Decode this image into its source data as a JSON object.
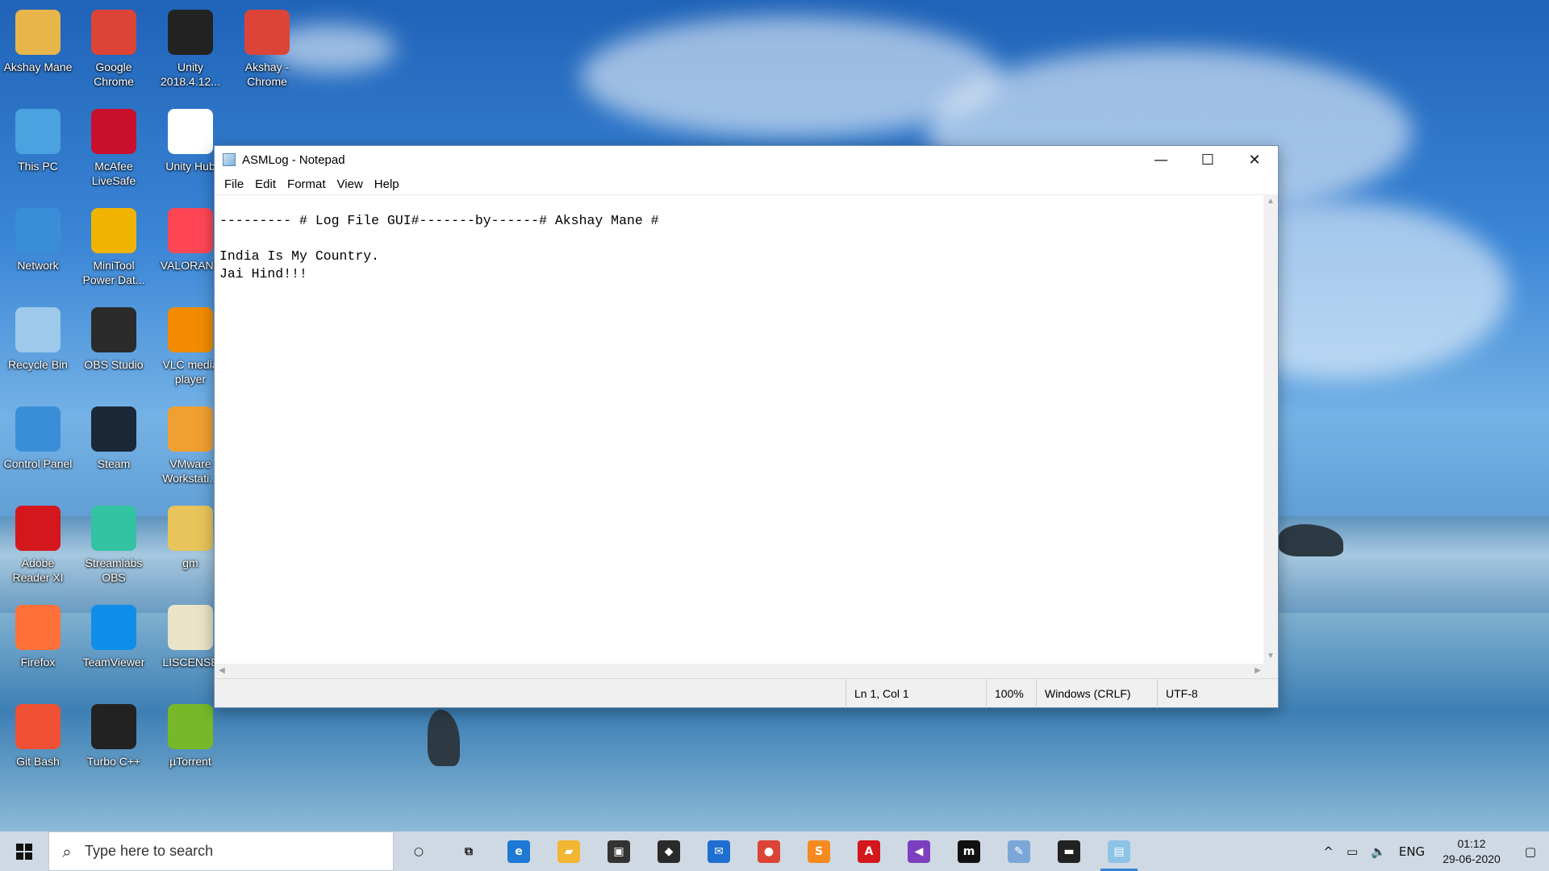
{
  "desktop": {
    "icons": [
      {
        "label": "Akshay Mane",
        "icon": "user-folder-icon",
        "color": "#e8b54a"
      },
      {
        "label": "Google Chrome",
        "icon": "chrome-icon",
        "color": "#db4437"
      },
      {
        "label": "Unity 2018.4.12...",
        "icon": "unity-icon",
        "color": "#222222"
      },
      {
        "label": "Akshay - Chrome",
        "icon": "chrome-profile-icon",
        "color": "#db4437"
      },
      {
        "label": "This PC",
        "icon": "computer-icon",
        "color": "#4aa3e0"
      },
      {
        "label": "McAfee LiveSafe",
        "icon": "mcafee-icon",
        "color": "#c8102e"
      },
      {
        "label": "Unity Hub",
        "icon": "unity-hub-icon",
        "color": "#ffffff"
      },
      {
        "label": "Network",
        "icon": "network-icon",
        "color": "#3a8ed8"
      },
      {
        "label": "MiniTool Power Dat...",
        "icon": "minitool-icon",
        "color": "#f0b400"
      },
      {
        "label": "VALORANT",
        "icon": "valorant-icon",
        "color": "#ff4655"
      },
      {
        "label": "Recycle Bin",
        "icon": "recycle-bin-icon",
        "color": "#9ec9ea"
      },
      {
        "label": "OBS Studio",
        "icon": "obs-icon",
        "color": "#2b2b2b"
      },
      {
        "label": "VLC media player",
        "icon": "vlc-icon",
        "color": "#f28b00"
      },
      {
        "label": "Control Panel",
        "icon": "control-panel-icon",
        "color": "#3a8ed8"
      },
      {
        "label": "Steam",
        "icon": "steam-icon",
        "color": "#1b2838"
      },
      {
        "label": "VMware Workstati...",
        "icon": "vmware-icon",
        "color": "#f0a030"
      },
      {
        "label": "Adobe Reader XI",
        "icon": "adobe-reader-icon",
        "color": "#d4171d"
      },
      {
        "label": "Streamlabs OBS",
        "icon": "streamlabs-icon",
        "color": "#31c3a2"
      },
      {
        "label": "gm",
        "icon": "folder-icon",
        "color": "#e8c45a"
      },
      {
        "label": "Firefox",
        "icon": "firefox-icon",
        "color": "#ff7139"
      },
      {
        "label": "TeamViewer",
        "icon": "teamviewer-icon",
        "color": "#0e8ee9"
      },
      {
        "label": "LISCENSE",
        "icon": "pdf-file-icon",
        "color": "#e9e3c8"
      },
      {
        "label": "Git Bash",
        "icon": "git-bash-icon",
        "color": "#f05033"
      },
      {
        "label": "Turbo C++",
        "icon": "turbo-cpp-icon",
        "color": "#222222"
      },
      {
        "label": "µTorrent",
        "icon": "utorrent-icon",
        "color": "#76b82a"
      }
    ]
  },
  "notepad": {
    "title": "ASMLog - Notepad",
    "controls": {
      "minimize": "—",
      "maximize": "☐",
      "close": "✕"
    },
    "menu": [
      "File",
      "Edit",
      "Format",
      "View",
      "Help"
    ],
    "content": "--------- # Log File GUI#-------by------# Akshay Mane #\n\nIndia Is My Country.\nJai Hind!!!",
    "status": {
      "position": "Ln 1, Col 1",
      "zoom": "100%",
      "line_ending": "Windows (CRLF)",
      "encoding": "UTF-8"
    }
  },
  "taskbar": {
    "search_placeholder": "Type here to search",
    "apps": [
      {
        "name": "cortana",
        "glyph": "○",
        "color": "transparent",
        "text_color": "#111111"
      },
      {
        "name": "task-view",
        "glyph": "⧉",
        "color": "transparent",
        "text_color": "#111111"
      },
      {
        "name": "edge",
        "glyph": "e",
        "color": "#1e78d4"
      },
      {
        "name": "file-explorer",
        "glyph": "▰",
        "color": "#f2b632"
      },
      {
        "name": "microsoft-store",
        "glyph": "▣",
        "color": "#333333"
      },
      {
        "name": "predator",
        "glyph": "◆",
        "color": "#2a2a2a"
      },
      {
        "name": "mail",
        "glyph": "✉",
        "color": "#1e6fd0"
      },
      {
        "name": "chrome",
        "glyph": "●",
        "color": "#db4437"
      },
      {
        "name": "sublime-text",
        "glyph": "S",
        "color": "#f58a1f"
      },
      {
        "name": "adobe-reader",
        "glyph": "A",
        "color": "#d4171d"
      },
      {
        "name": "visual-studio",
        "glyph": "◀",
        "color": "#7b3fbf"
      },
      {
        "name": "msdn",
        "glyph": "m",
        "color": "#111111"
      },
      {
        "name": "paint",
        "glyph": "✎",
        "color": "#7aa7d8"
      },
      {
        "name": "terminal",
        "glyph": "▬",
        "color": "#222222"
      },
      {
        "name": "notepad",
        "glyph": "▤",
        "color": "#8ec3e8",
        "active": true
      }
    ],
    "tray": {
      "chevron": "^",
      "battery": "▭",
      "volume": "🔈",
      "language": "ENG",
      "time": "01:12",
      "date": "29-06-2020",
      "notifications": "▢"
    }
  }
}
